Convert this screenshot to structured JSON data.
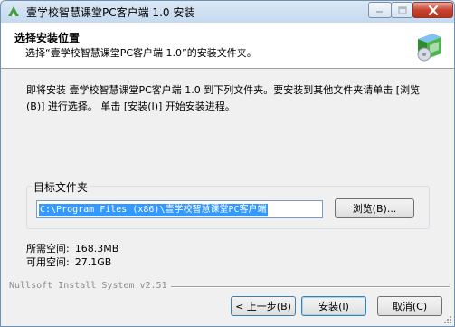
{
  "window": {
    "title": "壹学校智慧课堂PC客户端 1.0 安装",
    "controls": {
      "minimize_icon": "minimize-icon",
      "maximize_icon": "maximize-icon",
      "close_icon": "close-icon"
    }
  },
  "header": {
    "title": "选择安装位置",
    "subtitle": "选择“壹学校智慧课堂PC客户端 1.0”的安装文件夹。",
    "icon": "installer-box-icon"
  },
  "body": {
    "description": "即将安装 壹学校智慧课堂PC客户端 1.0 到下列文件夹。要安装到其他文件夹请单击 [浏览(B)] 进行选择。 单击 [安装(I)] 开始安装进程。"
  },
  "destination": {
    "group_label": "目标文件夹",
    "path_value": "C:\\Program Files (x86)\\壹学校智慧课堂PC客户端",
    "browse_label": "浏览(B)..."
  },
  "space": {
    "required_label": "所需空间:",
    "required_value": "168.3MB",
    "available_label": "可用空间:",
    "available_value": "27.1GB"
  },
  "footer": {
    "brand": "Nullsoft Install System v2.51",
    "back_label": "< 上一步(B)",
    "install_label": "安装(I)",
    "cancel_label": "取消(C)"
  },
  "colors": {
    "selection": "#3399ff",
    "close_button": "#c8442f",
    "titlebar": "#c5d9ef"
  }
}
